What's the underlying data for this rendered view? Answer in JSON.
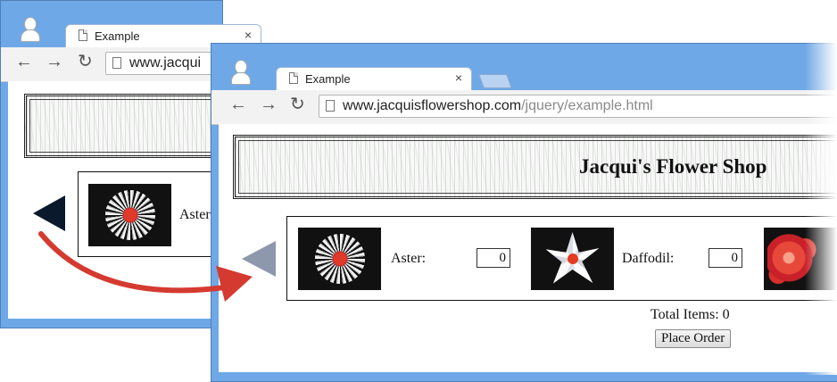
{
  "back_window": {
    "tab_title": "Example",
    "tab_close": "×",
    "url_visible": "www.jacqui",
    "flower_label_partial": "Aster"
  },
  "front_window": {
    "tab_title": "Example",
    "tab_close": "×",
    "url_host": "www.jacquisflowershop.com",
    "url_path": "/jquery/example.html",
    "shop_title": "Jacqui's Flower Shop",
    "products": [
      {
        "label": "Aster:",
        "quantity": "0"
      },
      {
        "label": "Daffodil:",
        "quantity": "0"
      }
    ],
    "total_items": "Total Items: 0",
    "place_order": "Place Order"
  },
  "nav": {
    "back": "←",
    "forward": "→",
    "reload": "↻"
  },
  "colors": {
    "window_frame": "#6fa8e6",
    "nav_arrow": "#0a1a2c",
    "transition_arrow": "#d43a30"
  }
}
